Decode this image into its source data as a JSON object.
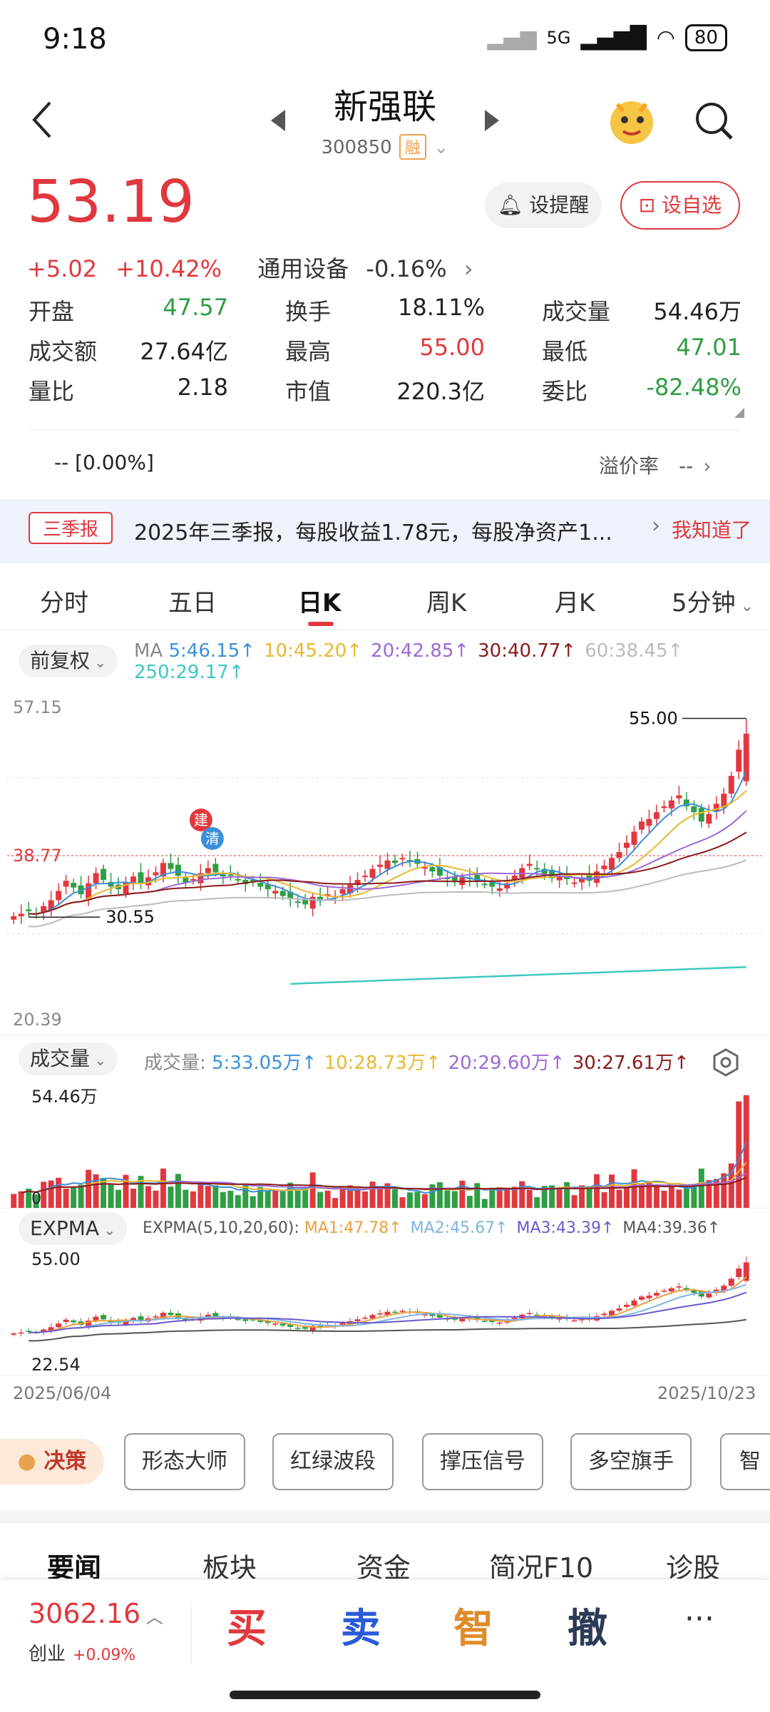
{
  "status": {
    "time": "9:18",
    "net": "5G",
    "battery": "80"
  },
  "header": {
    "name": "新强联",
    "code": "300850",
    "tag": "融"
  },
  "quote": {
    "price": "53.19",
    "change": "+5.02",
    "change_pct": "+10.42%",
    "sector": "通用设备",
    "sector_pct": "-0.16%",
    "alert_label": "设提醒",
    "watch_label": "设自选",
    "rows": [
      [
        {
          "label": "开盘",
          "value": "47.57",
          "color": "green"
        },
        {
          "label": "换手",
          "value": "18.11%",
          "color": "dark"
        },
        {
          "label": "成交量",
          "value": "54.46万",
          "color": "dark"
        }
      ],
      [
        {
          "label": "成交额",
          "value": "27.64亿",
          "color": "dark"
        },
        {
          "label": "最高",
          "value": "55.00",
          "color": "red"
        },
        {
          "label": "最低",
          "value": "47.01",
          "color": "green"
        }
      ],
      [
        {
          "label": "量比",
          "value": "2.18",
          "color": "dark"
        },
        {
          "label": "市值",
          "value": "220.3亿",
          "color": "dark"
        },
        {
          "label": "委比",
          "value": "-82.48%",
          "color": "green"
        }
      ]
    ],
    "premium_left": "--  [0.00%]",
    "premium_label": "溢价率",
    "premium_value": "--"
  },
  "notice": {
    "tag": "三季报",
    "text": "2025年三季报，每股收益1.78元，每股净资产1...",
    "action": "我知道了"
  },
  "tabs": [
    "分时",
    "五日",
    "日K",
    "周K",
    "月K",
    "5分钟"
  ],
  "active_tab": "日K",
  "chart_data": {
    "type": "candlestick",
    "adjust_label": "前复权",
    "ma_label": "MA",
    "ma": [
      {
        "name": "5",
        "value": "46.15",
        "color": "#3b8fd9"
      },
      {
        "name": "10",
        "value": "45.20",
        "color": "#e8b830"
      },
      {
        "name": "20",
        "value": "42.85",
        "color": "#9b6ad6"
      },
      {
        "name": "30",
        "value": "40.77",
        "color": "#8b1a1a"
      },
      {
        "name": "60",
        "value": "38.45",
        "color": "#bbbbbb"
      },
      {
        "name": "250",
        "value": "29.17",
        "color": "#3ec8c0"
      }
    ],
    "y_axis": {
      "top": "57.15",
      "mid": "38.77",
      "bottom": "20.39"
    },
    "max_label": "55.00",
    "min_label": "30.55",
    "marker_build": "建",
    "marker_clear": "清",
    "closes": [
      31.6,
      31.9,
      32.2,
      31.8,
      32.8,
      33.5,
      34.6,
      35.8,
      35.0,
      34.2,
      35.5,
      36.7,
      35.9,
      35.1,
      34.8,
      35.6,
      36.3,
      35.5,
      36.2,
      36.8,
      37.9,
      37.2,
      36.4,
      35.6,
      36.0,
      36.7,
      37.3,
      36.8,
      36.3,
      36.5,
      35.9,
      35.4,
      35.8,
      35.1,
      34.8,
      34.6,
      34.0,
      33.6,
      33.3,
      33.0,
      33.9,
      33.5,
      34.2,
      34.0,
      34.8,
      35.3,
      35.9,
      36.4,
      37.2,
      37.7,
      38.2,
      37.9,
      38.5,
      38.1,
      37.8,
      37.4,
      36.9,
      36.4,
      36.0,
      35.8,
      36.2,
      36.0,
      35.7,
      35.4,
      35.1,
      34.9,
      35.5,
      36.4,
      37.3,
      37.8,
      37.2,
      36.6,
      36.1,
      36.4,
      36.0,
      35.6,
      36.1,
      35.8,
      36.9,
      37.6,
      38.5,
      39.2,
      40.3,
      41.6,
      42.8,
      43.1,
      43.9,
      44.6,
      45.3,
      45.9,
      44.6,
      43.9,
      42.8,
      43.7,
      44.9,
      46.1,
      48.2,
      51.3,
      53.19
    ],
    "volume": {
      "label": "成交量",
      "title": "成交量:",
      "max_label": "54.46万",
      "zero_label": "0",
      "ma": [
        {
          "name": "5",
          "value": "33.05万",
          "color": "#3b8fd9"
        },
        {
          "name": "10",
          "value": "28.73万",
          "color": "#e8b830"
        },
        {
          "name": "20",
          "value": "29.60万",
          "color": "#9b6ad6"
        },
        {
          "name": "30",
          "value": "27.61万",
          "color": "#8b1a1a"
        }
      ]
    },
    "expma": {
      "label": "EXPMA",
      "params": "EXPMA(5,10,20,60):",
      "top": "55.00",
      "bottom": "22.54",
      "lines": [
        {
          "name": "MA1",
          "value": "47.78",
          "color": "#e8a040"
        },
        {
          "name": "MA2",
          "value": "45.67",
          "color": "#7fb3e0"
        },
        {
          "name": "MA3",
          "value": "43.39",
          "color": "#6a5acd"
        },
        {
          "name": "MA4",
          "value": "39.36",
          "color": "#555555"
        }
      ]
    },
    "start_date": "2025/06/04",
    "end_date": "2025/10/23"
  },
  "tools": {
    "decision": "决策",
    "items": [
      "形态大师",
      "红绿波段",
      "撑压信号",
      "多空旗手",
      "智"
    ]
  },
  "news_tabs": [
    "要闻",
    "板块",
    "资金",
    "简况F10",
    "诊股"
  ],
  "bottom": {
    "index": "3062.16",
    "index_name": "创业",
    "index_pct": "+0.09%",
    "buy": "买",
    "sell": "卖",
    "smart": "智",
    "cancel": "撤",
    "more": "···"
  }
}
